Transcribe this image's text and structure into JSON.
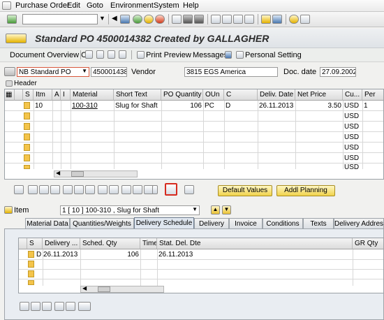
{
  "menu": [
    "Purchase Order",
    "Edit",
    "Goto",
    "Environment",
    "System",
    "Help"
  ],
  "window_title": "Standard PO 4500014382 Created by GALLAGHER",
  "app_toolbar": {
    "doc_overview": "Document Overview On",
    "print_preview": "Print Preview",
    "messages": "Messages",
    "personal_setting": "Personal Setting"
  },
  "header_fields": {
    "doc_type": "NB Standard PO",
    "po_number": "4500014382",
    "vendor_label": "Vendor",
    "vendor_value": "3815 EGS America",
    "doc_date_label": "Doc. date",
    "doc_date_value": "27.09.2002"
  },
  "header_label": "Header",
  "items_table": {
    "columns": [
      "S",
      "Itm",
      "A",
      "I",
      "Material",
      "Short Text",
      "PO Quantity",
      "OUn",
      "C",
      "Deliv. Date",
      "Net Price",
      "Cu...",
      "Per"
    ],
    "rows": [
      {
        "itm": "10",
        "material": "100-310",
        "short_text": "Slug for Shaft",
        "qty": "106",
        "oun": "PC",
        "c": "D",
        "deliv_date": "26.11.2013",
        "net_price": "3.50",
        "cu": "USD",
        "per": "1"
      },
      {
        "cu": "USD"
      },
      {
        "cu": "USD"
      },
      {
        "cu": "USD"
      },
      {
        "cu": "USD"
      },
      {
        "cu": "USD"
      },
      {
        "cu": "USD"
      }
    ]
  },
  "buttons": {
    "default_values": "Default Values",
    "addl_planning": "Addl Planning"
  },
  "item_selector": {
    "label": "Item",
    "value": "1 [ 10 ] 100-310 , Slug for Shaft"
  },
  "tabs": [
    "Material Data",
    "Quantities/Weights",
    "Delivery Schedule",
    "Delivery",
    "Invoice",
    "Conditions",
    "Texts",
    "Delivery Address"
  ],
  "active_tab": "Delivery Schedule",
  "schedule_table": {
    "columns": [
      "S",
      "Delivery ...",
      "Sched. Qty",
      "Time",
      "Stat. Del. Dte",
      "GR Qty"
    ],
    "rows": [
      {
        "s": "D",
        "delivery": "26.11.2013",
        "sched_qty": "106",
        "stat_del": "26.11.2013"
      }
    ]
  }
}
